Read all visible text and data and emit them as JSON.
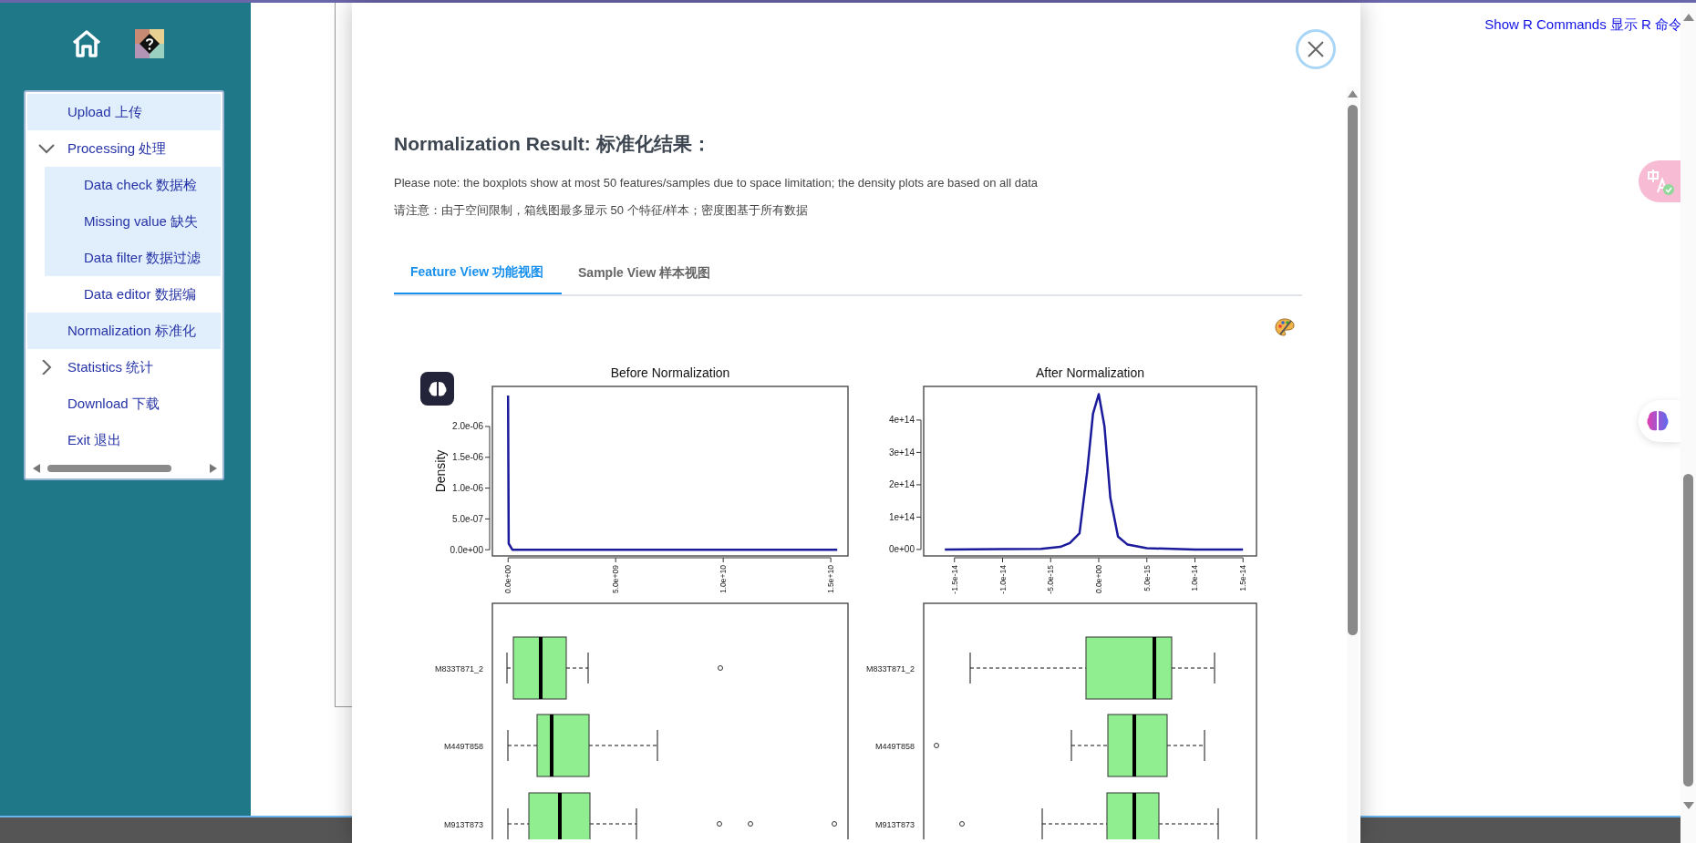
{
  "sidebar": {
    "items": [
      {
        "label": "Upload  上传",
        "selected": true
      },
      {
        "label": "Processing  处理",
        "selected": false,
        "expanded": true,
        "children": [
          {
            "label": "Data check  数据检",
            "selected": true
          },
          {
            "label": "Missing value  缺失",
            "selected": true
          },
          {
            "label": "Data filter  数据过滤",
            "selected": true
          },
          {
            "label": "Data editor  数据编",
            "selected": false
          }
        ]
      },
      {
        "label": "Normalization  标准化",
        "selected": true
      },
      {
        "label": "Statistics  统计",
        "selected": false,
        "expanded": false
      },
      {
        "label": "Download  下载",
        "selected": false
      },
      {
        "label": "Exit  退出",
        "selected": false
      }
    ]
  },
  "header_link": "Show R Commands  显示 R 命令",
  "modal": {
    "title": "Normalization Result:  标准化结果：",
    "notes": [
      "Please note: the boxplots show at most 50 features/samples due to space limitation; the density plots are based on all data",
      "请注意：由于空间限制，箱线图最多显示 50 个特征/样本；密度图基于所有数据"
    ],
    "tabs": [
      {
        "label": "Feature View  功能视图",
        "selected": true
      },
      {
        "label": "Sample View  样本视图",
        "selected": false
      }
    ],
    "density_plots": [
      {
        "chart_data": {
          "type": "line",
          "title": "Before Normalization",
          "ylabel": "Density",
          "xlim": [
            -730000000,
            15800000000
          ],
          "ylim": [
            -1e-07,
            2.65e-06
          ],
          "xticks": [
            {
              "value": 0,
              "label": "0.0e+00"
            },
            {
              "value": 5000000000,
              "label": "5.0e+09"
            },
            {
              "value": 10000000000,
              "label": "1.0e+10"
            },
            {
              "value": 15000000000,
              "label": "1.5e+10"
            }
          ],
          "yticks": [
            {
              "value": 0,
              "label": "0.0e+00"
            },
            {
              "value": 5e-07,
              "label": "5.0e-07"
            },
            {
              "value": 1e-06,
              "label": "1.0e-06"
            },
            {
              "value": 1.5e-06,
              "label": "1.5e-06"
            },
            {
              "value": 2e-06,
              "label": "2.0e-06"
            }
          ],
          "x": [
            0,
            30000000,
            200000000,
            15300000000
          ],
          "series": [
            {
              "color": "#1a1a9a",
              "values": [
                2.5e-06,
                1e-07,
                0,
                0
              ]
            }
          ]
        }
      },
      {
        "chart_data": {
          "type": "line",
          "title": "After Normalization",
          "xlim": [
            -1.82e-14,
            1.64e-14
          ],
          "ylim": [
            -20000000000000.0,
            504000000000000.0
          ],
          "xticks": [
            {
              "value": -1.5e-14,
              "label": "-1.5e-14"
            },
            {
              "value": -1e-14,
              "label": "-1.0e-14"
            },
            {
              "value": -5e-15,
              "label": "-5.0e-15"
            },
            {
              "value": 0,
              "label": "0.0e+00"
            },
            {
              "value": 5e-15,
              "label": "5.0e-15"
            },
            {
              "value": 1e-14,
              "label": "1.0e-14"
            },
            {
              "value": 1.5e-14,
              "label": "1.5e-14"
            }
          ],
          "yticks": [
            {
              "value": 0,
              "label": "0e+00"
            },
            {
              "value": 100000000000000.0,
              "label": "1e+14"
            },
            {
              "value": 200000000000000.0,
              "label": "2e+14"
            },
            {
              "value": 300000000000000.0,
              "label": "3e+14"
            },
            {
              "value": 400000000000000.0,
              "label": "4e+14"
            }
          ],
          "x": [
            -1.6e-14,
            -1e-14,
            -6e-15,
            -4e-15,
            -3e-15,
            -2e-15,
            -1.2e-15,
            -6e-16,
            0,
            6e-16,
            1.2e-15,
            2e-15,
            3e-15,
            5e-15,
            1e-14,
            1.5e-14
          ],
          "series": [
            {
              "color": "#1a1a9a",
              "values": [
                0,
                1000000000000.0,
                2000000000000.0,
                8000000000000.0,
                20000000000000.0,
                50000000000000.0,
                240000000000000.0,
                420000000000000.0,
                480000000000000.0,
                380000000000000.0,
                160000000000000.0,
                40000000000000.0,
                15000000000000.0,
                4000000000000.0,
                0,
                0
              ]
            }
          ]
        }
      }
    ],
    "boxplots": [
      {
        "row_labels": [
          "M833T871_2",
          "M449T858",
          "M913T873"
        ]
      },
      {
        "row_labels": [
          "M833T871_2",
          "M449T858",
          "M913T873"
        ]
      }
    ]
  }
}
